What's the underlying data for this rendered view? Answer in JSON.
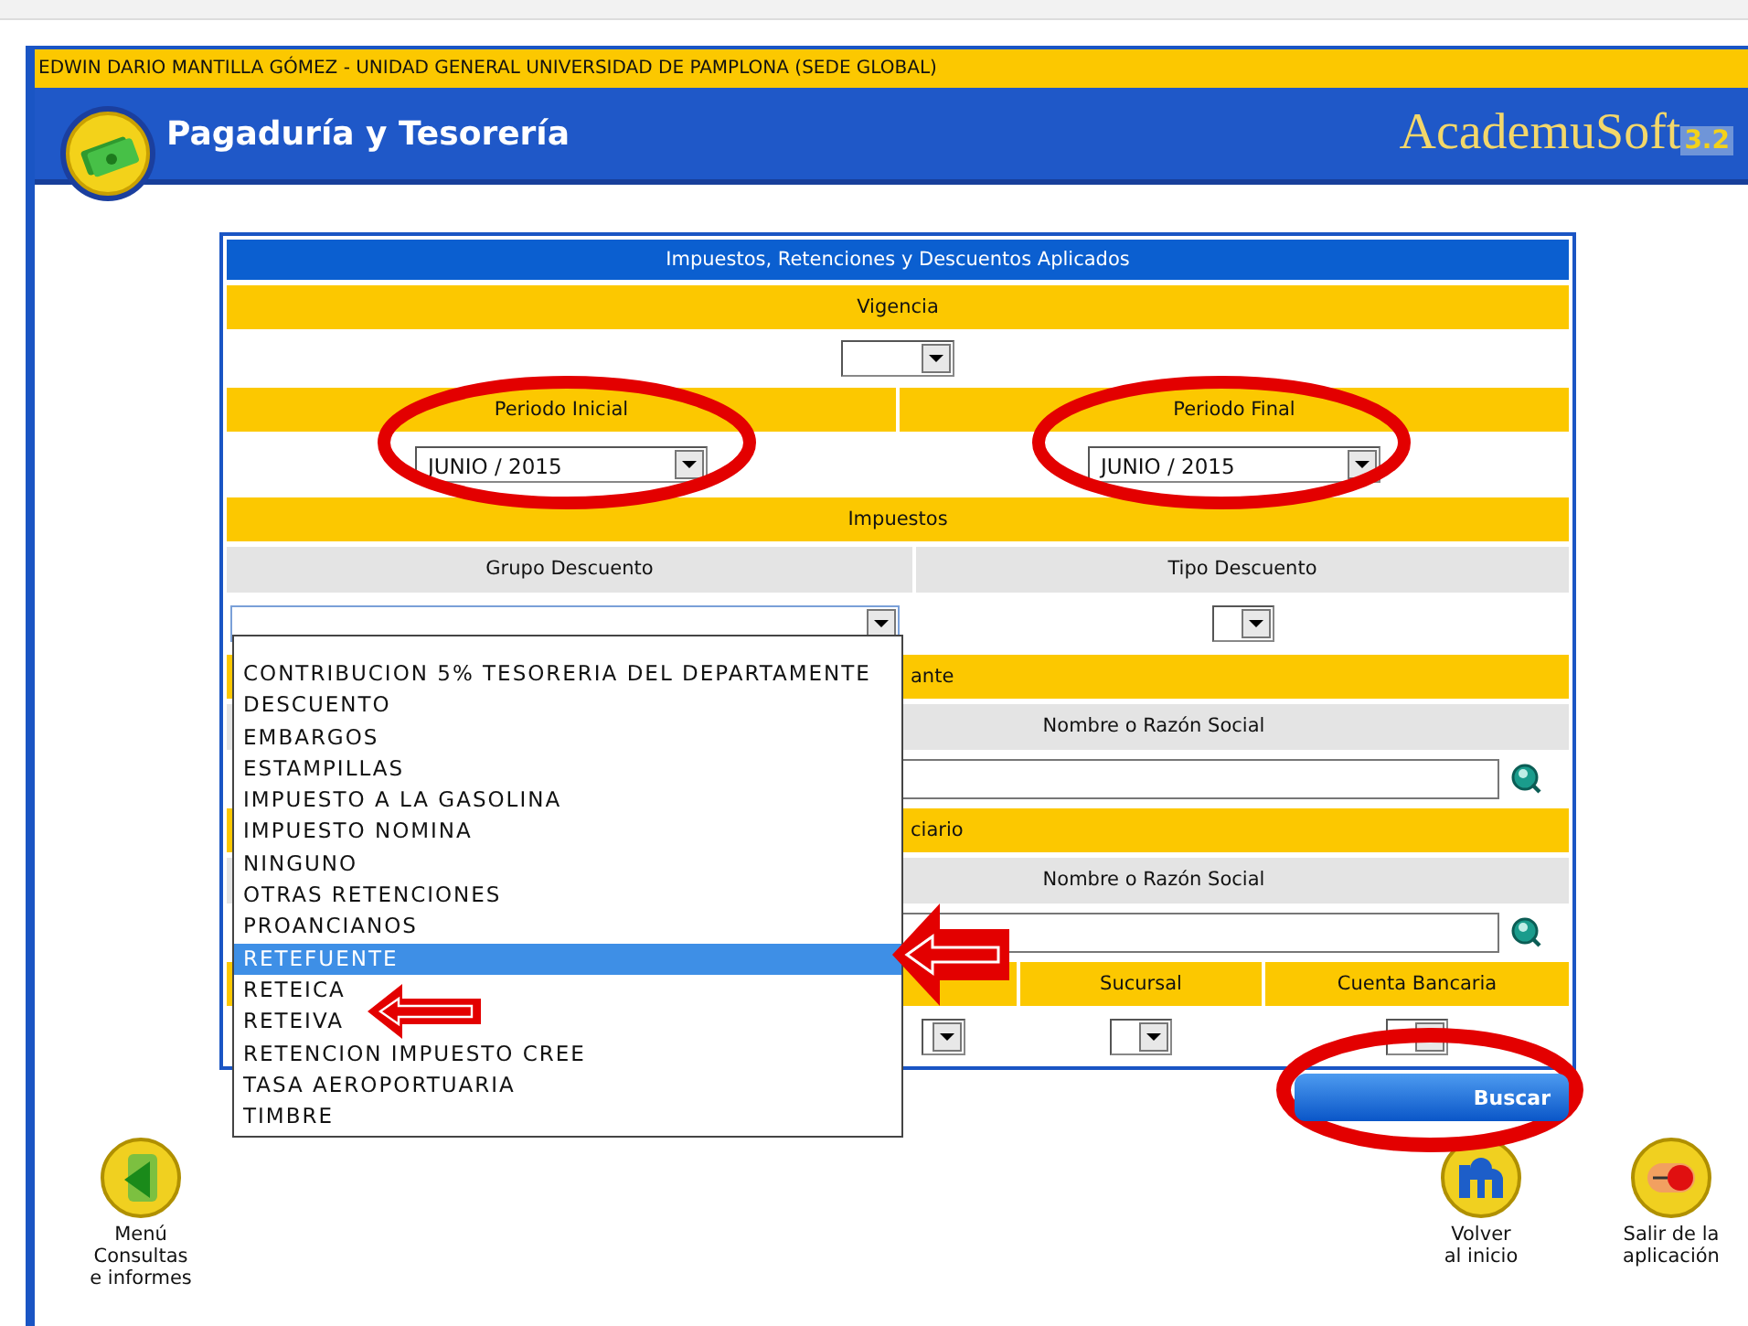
{
  "user_bar": "EDWIN DARIO MANTILLA GÓMEZ - UNIDAD GENERAL UNIVERSIDAD DE PAMPLONA (SEDE GLOBAL)",
  "app": {
    "title": "Pagaduría y Tesorería",
    "logo": "AcademuSoft",
    "logo_version": "3.2"
  },
  "form": {
    "title": "Impuestos, Retenciones y Descuentos Aplicados",
    "vigencia": {
      "label": "Vigencia"
    },
    "periodo_inicial": {
      "label": "Periodo Inicial",
      "value": "JUNIO / 2015"
    },
    "periodo_final": {
      "label": "Periodo Final",
      "value": "JUNIO / 2015"
    },
    "impuestos": {
      "label": "Impuestos"
    },
    "grupo_descuento": {
      "label": "Grupo Descuento",
      "expanded": true,
      "options": [
        {
          "label": "CONTRIBUCION 5% TESORERIA DEL DEPARTAMENTE",
          "selected": false
        },
        {
          "label": "DESCUENTO",
          "selected": false
        },
        {
          "label": "EMBARGOS",
          "selected": false
        },
        {
          "label": "ESTAMPILLAS",
          "selected": false
        },
        {
          "label": "IMPUESTO A LA GASOLINA",
          "selected": false
        },
        {
          "label": "IMPUESTO NOMINA",
          "selected": false
        },
        {
          "label": "NINGUNO",
          "selected": false
        },
        {
          "label": "OTRAS RETENCIONES",
          "selected": false
        },
        {
          "label": "PROANCIANOS",
          "selected": false
        },
        {
          "label": "RETEFUENTE",
          "selected": true
        },
        {
          "label": "RETEICA",
          "selected": false
        },
        {
          "label": "RETEIVA",
          "selected": false
        },
        {
          "label": "RETENCION IMPUESTO CREE",
          "selected": false
        },
        {
          "label": "TASA AEROPORTUARIA",
          "selected": false
        },
        {
          "label": "TIMBRE",
          "selected": false
        }
      ]
    },
    "tipo_descuento": {
      "label": "Tipo Descuento"
    },
    "section_1": {
      "label": "ante",
      "name_label": "Nombre o Razón Social"
    },
    "section_2": {
      "label": "ciario",
      "name_label": "Nombre o Razón Social"
    },
    "sucursal": {
      "label": "Sucursal"
    },
    "cuenta_bancaria": {
      "label": "Cuenta Bancaria"
    },
    "search_button": "Buscar"
  },
  "footer": [
    {
      "lines": [
        "Menú",
        "Consultas",
        "e informes"
      ],
      "kind": "menu"
    },
    {
      "lines": [
        "Volver",
        "al inicio"
      ],
      "kind": "home"
    },
    {
      "lines": [
        "Salir de la",
        "aplicación"
      ],
      "kind": "exit"
    }
  ]
}
